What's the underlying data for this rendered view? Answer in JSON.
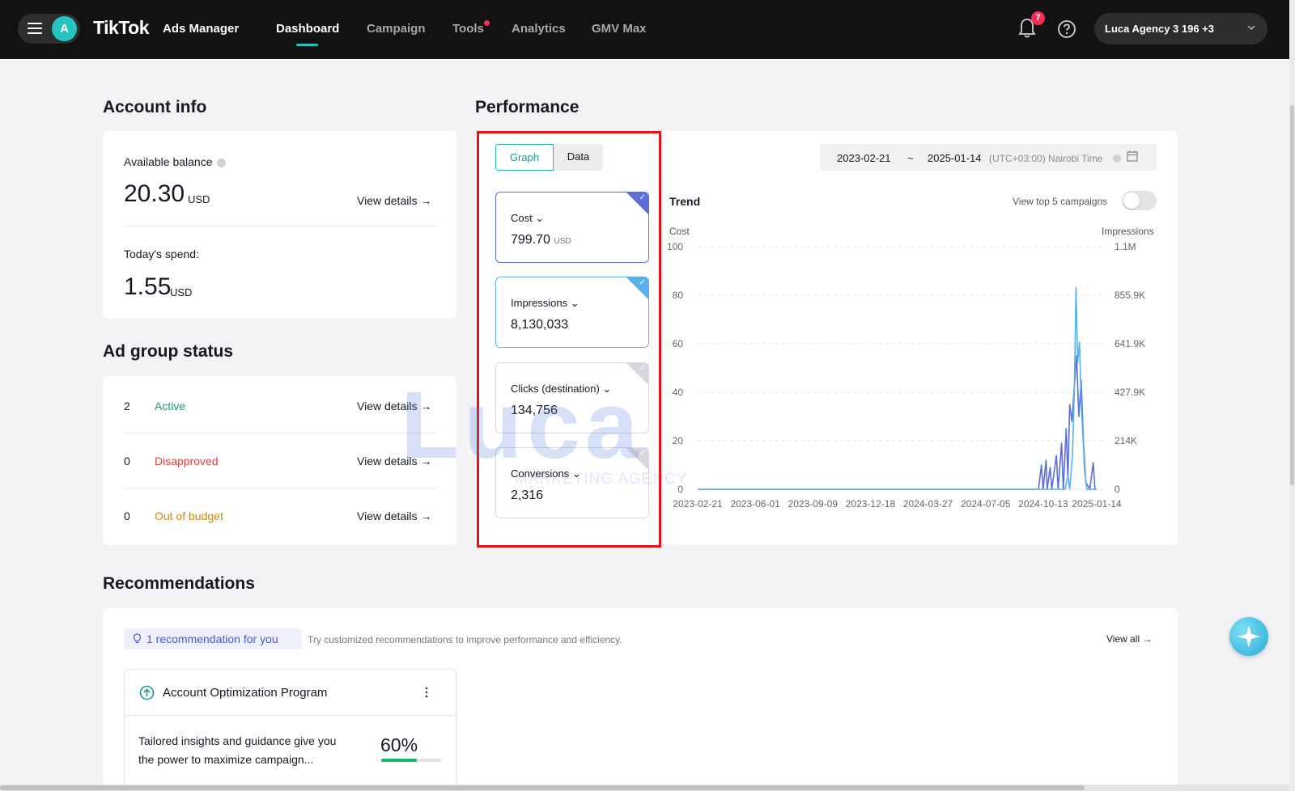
{
  "header": {
    "brand": "TikTok",
    "brand_sub": "Ads Manager",
    "avatar_letter": "A",
    "nav": [
      {
        "label": "Dashboard",
        "active": true
      },
      {
        "label": "Campaign",
        "active": false
      },
      {
        "label": "Tools",
        "active": false,
        "dot": true
      },
      {
        "label": "Analytics",
        "active": false
      },
      {
        "label": "GMV Max",
        "active": false
      }
    ],
    "notifications_count": "7",
    "account_name": "Luca Agency 3 196 +3"
  },
  "account_info": {
    "title": "Account info",
    "available_balance_label": "Available balance",
    "balance_value": "20.30",
    "balance_unit": "USD",
    "view_details": "View details →",
    "todays_spend_label": "Today's spend:",
    "spend_value": "1.55",
    "spend_unit": "USD"
  },
  "ad_group_status": {
    "title": "Ad group status",
    "rows": [
      {
        "count": "2",
        "label": "Active",
        "color": "#1a9b6b",
        "link": "View details →"
      },
      {
        "count": "0",
        "label": "Disapproved",
        "color": "#e0423b",
        "link": "View details →"
      },
      {
        "count": "0",
        "label": "Out of budget",
        "color": "#c88a12",
        "link": "View details →"
      }
    ]
  },
  "performance": {
    "title": "Performance",
    "tabs": [
      "Graph",
      "Data"
    ],
    "active_tab": "Graph",
    "metrics": [
      {
        "name": "Cost",
        "value": "799.70",
        "unit": "USD",
        "selected": "blue"
      },
      {
        "name": "Impressions",
        "value": "8,130,033",
        "unit": "",
        "selected": "cyan"
      },
      {
        "name": "Clicks (destination)",
        "value": "134,756",
        "unit": "",
        "selected": "none"
      },
      {
        "name": "Conversions",
        "value": "2,316",
        "unit": "",
        "selected": "none"
      }
    ],
    "date_start": "2023-02-21",
    "date_sep": "~",
    "date_end": "2025-01-14",
    "timezone": "(UTC+03:00) Nairobi Time",
    "trend_title": "Trend",
    "view_top5": "View top 5 campaigns",
    "view_top5_on": false,
    "left_axis_name": "Cost",
    "right_axis_name": "Impressions"
  },
  "chart_data": {
    "type": "line",
    "x_tick_labels": [
      "2023-02-21",
      "2023-06-01",
      "2023-09-09",
      "2023-12-18",
      "2024-03-27",
      "2024-07-05",
      "2024-10-13",
      "2025-01-14"
    ],
    "y_left_ticks": [
      "0",
      "20",
      "40",
      "60",
      "80",
      "100"
    ],
    "y_right_ticks": [
      "0",
      "214K",
      "427.9K",
      "641.9K",
      "855.9K",
      "1.1M"
    ],
    "ylim_left": [
      0,
      100
    ],
    "ylim_right": [
      0,
      1070000
    ],
    "series": [
      {
        "name": "Cost",
        "axis": "left",
        "color": "#5a6fd8",
        "points": [
          [
            "2023-02-21",
            0
          ],
          [
            "2024-10-05",
            0
          ],
          [
            "2024-10-10",
            10
          ],
          [
            "2024-10-13",
            0
          ],
          [
            "2024-10-18",
            12
          ],
          [
            "2024-10-20",
            0
          ],
          [
            "2024-10-25",
            9
          ],
          [
            "2024-10-28",
            0
          ],
          [
            "2024-11-05",
            14
          ],
          [
            "2024-11-08",
            0
          ],
          [
            "2024-11-14",
            19
          ],
          [
            "2024-11-17",
            0
          ],
          [
            "2024-11-22",
            25
          ],
          [
            "2024-11-25",
            4
          ],
          [
            "2024-11-28",
            35
          ],
          [
            "2024-12-02",
            28
          ],
          [
            "2024-12-06",
            42
          ],
          [
            "2024-12-10",
            55
          ],
          [
            "2024-12-14",
            30
          ],
          [
            "2024-12-18",
            45
          ],
          [
            "2024-12-22",
            20
          ],
          [
            "2024-12-26",
            3
          ],
          [
            "2025-01-02",
            0
          ],
          [
            "2025-01-08",
            11
          ],
          [
            "2025-01-11",
            0
          ],
          [
            "2025-01-14",
            0
          ]
        ]
      },
      {
        "name": "Impressions",
        "axis": "right",
        "color": "#5ab0e8",
        "points": [
          [
            "2023-02-21",
            0
          ],
          [
            "2024-11-20",
            0
          ],
          [
            "2024-11-25",
            60000
          ],
          [
            "2024-11-28",
            0
          ],
          [
            "2024-12-03",
            150000
          ],
          [
            "2024-12-06",
            420000
          ],
          [
            "2024-12-09",
            890000
          ],
          [
            "2024-12-12",
            560000
          ],
          [
            "2024-12-15",
            650000
          ],
          [
            "2024-12-18",
            380000
          ],
          [
            "2024-12-21",
            240000
          ],
          [
            "2024-12-24",
            80000
          ],
          [
            "2024-12-28",
            0
          ],
          [
            "2025-01-14",
            0
          ]
        ]
      }
    ]
  },
  "recommendations": {
    "title": "Recommendations",
    "chip": "1 recommendation for you",
    "description": "Try customized recommendations to improve performance and efficiency.",
    "view_all": "View all →",
    "card_title": "Account Optimization Program",
    "card_text_line1": "Tailored insights and guidance give you",
    "card_text_line2": "the power to maximize campaign...",
    "progress_label": "60%",
    "progress_value": 0.6
  },
  "watermark": {
    "main": "Luca",
    "sub": "MARKETING AGENCY"
  }
}
